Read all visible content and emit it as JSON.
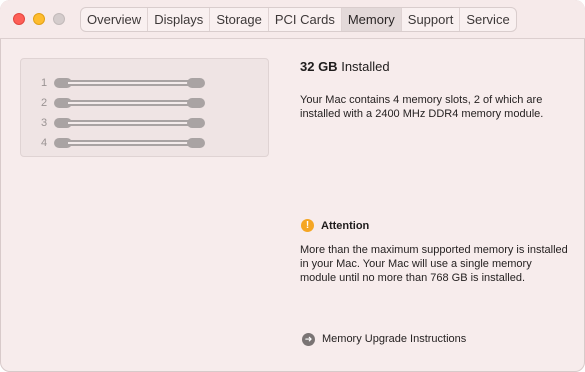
{
  "window": {
    "controls": [
      "close",
      "minimize",
      "zoom"
    ]
  },
  "tabs": [
    {
      "label": "Overview",
      "active": false
    },
    {
      "label": "Displays",
      "active": false
    },
    {
      "label": "Storage",
      "active": false
    },
    {
      "label": "PCI Cards",
      "active": false
    },
    {
      "label": "Memory",
      "active": true
    },
    {
      "label": "Support",
      "active": false
    },
    {
      "label": "Service",
      "active": false
    }
  ],
  "slots": [
    {
      "number": "1"
    },
    {
      "number": "2"
    },
    {
      "number": "3"
    },
    {
      "number": "4"
    }
  ],
  "memory": {
    "amount": "32 GB",
    "installed_label": "Installed",
    "description": "Your Mac contains 4 memory slots, 2 of which are installed with a 2400 MHz DDR4 memory module."
  },
  "attention": {
    "title": "Attention",
    "icon": "exclamation",
    "text": "More than the maximum supported memory is installed in your Mac. Your Mac will use a single memory module until no more than 768 GB is installed."
  },
  "upgrade": {
    "label": "Memory Upgrade Instructions",
    "icon": "arrow-right-circle"
  }
}
